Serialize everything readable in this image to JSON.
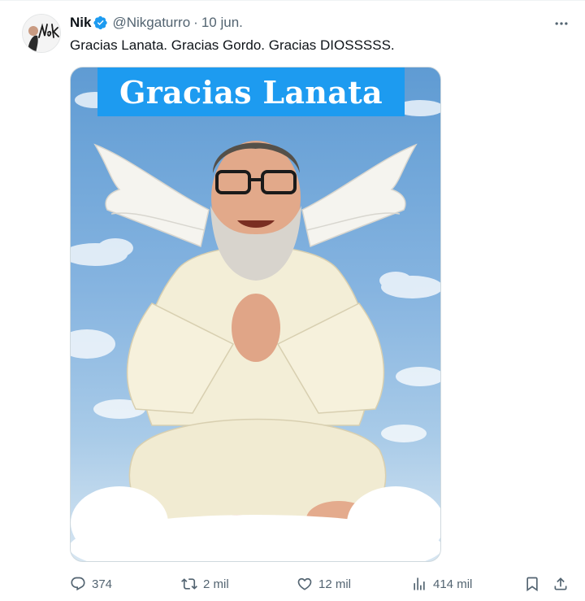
{
  "post": {
    "author_name": "Nik",
    "handle": "@Nikgaturro",
    "separator": "·",
    "date": "10 jun.",
    "text": "Gracias Lanata. Gracias Gordo. Gracias DIOSSSSS.",
    "avatar_signature": "Nik"
  },
  "media": {
    "banner_text": "Gracias Lanata"
  },
  "actions": {
    "replies": "374",
    "reposts": "2 mil",
    "likes": "12 mil",
    "views": "414 mil"
  },
  "icons": {
    "verified": "verified-badge-icon",
    "more": "more-icon",
    "reply": "reply-icon",
    "repost": "repost-icon",
    "like": "like-icon",
    "views": "views-icon",
    "bookmark": "bookmark-icon",
    "share": "share-icon"
  },
  "colors": {
    "accent": "#1d9bf0",
    "text_primary": "#0f1419",
    "text_secondary": "#536471"
  }
}
